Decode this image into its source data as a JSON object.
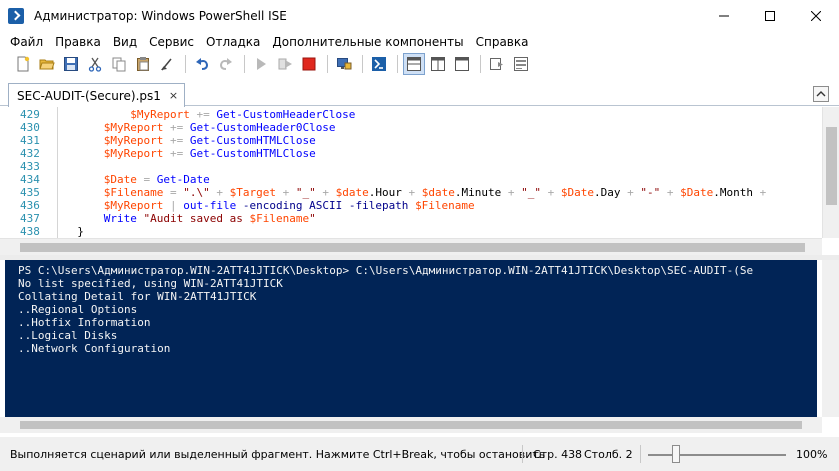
{
  "window": {
    "title": "Администратор: Windows PowerShell ISE",
    "controls": [
      "minimize-icon",
      "maximize-icon",
      "close-icon"
    ]
  },
  "menu": [
    "Файл",
    "Правка",
    "Вид",
    "Сервис",
    "Отладка",
    "Дополнительные компоненты",
    "Справка"
  ],
  "toolbar": {
    "buttons": [
      "new-icon",
      "open-icon",
      "save-icon",
      "cut-icon",
      "copy-icon",
      "paste-icon",
      "clear-icon",
      "undo-icon",
      "redo-icon",
      "run-icon",
      "run-selection-icon",
      "stop-icon",
      "remote-icon",
      "console-icon",
      "layout-top-icon",
      "layout-right-icon",
      "layout-max-icon",
      "snippets-icon",
      "commands-icon"
    ]
  },
  "tab": {
    "label": "SEC-AUDIT-(Secure).ps1",
    "close": "×"
  },
  "editor": {
    "lines": [
      {
        "num": "429",
        "code": [
          [
            "o",
            "          "
          ],
          [
            "v",
            "$MyReport"
          ],
          [
            "o",
            " += "
          ],
          [
            "c",
            "Get-CustomHeaderClose"
          ]
        ]
      },
      {
        "num": "430",
        "code": [
          [
            "o",
            "      "
          ],
          [
            "v",
            "$MyReport"
          ],
          [
            "o",
            " += "
          ],
          [
            "c",
            "Get-CustomHeader0Close"
          ]
        ]
      },
      {
        "num": "431",
        "code": [
          [
            "o",
            "      "
          ],
          [
            "v",
            "$MyReport"
          ],
          [
            "o",
            " += "
          ],
          [
            "c",
            "Get-CustomHTMLClose"
          ]
        ]
      },
      {
        "num": "432",
        "code": [
          [
            "o",
            "      "
          ],
          [
            "v",
            "$MyReport"
          ],
          [
            "o",
            " += "
          ],
          [
            "c",
            "Get-CustomHTMLClose"
          ]
        ]
      },
      {
        "num": "433",
        "code": []
      },
      {
        "num": "434",
        "code": [
          [
            "o",
            "      "
          ],
          [
            "v",
            "$Date"
          ],
          [
            "o",
            " = "
          ],
          [
            "c",
            "Get-Date"
          ]
        ]
      },
      {
        "num": "435",
        "code": [
          [
            "o",
            "      "
          ],
          [
            "v",
            "$Filename"
          ],
          [
            "o",
            " = "
          ],
          [
            "s",
            "\".\\\""
          ],
          [
            "o",
            " + "
          ],
          [
            "v",
            "$Target"
          ],
          [
            "o",
            " + "
          ],
          [
            "s",
            "\"_\""
          ],
          [
            "o",
            " + "
          ],
          [
            "v",
            "$date"
          ],
          [
            "t",
            "."
          ],
          [
            "t",
            "Hour"
          ],
          [
            "o",
            " + "
          ],
          [
            "v",
            "$date"
          ],
          [
            "t",
            ".Minute"
          ],
          [
            "o",
            " + "
          ],
          [
            "s",
            "\"_\""
          ],
          [
            "o",
            " + "
          ],
          [
            "v",
            "$Date"
          ],
          [
            "t",
            ".Day"
          ],
          [
            "o",
            " + "
          ],
          [
            "s",
            "\"-\""
          ],
          [
            "o",
            " + "
          ],
          [
            "v",
            "$Date"
          ],
          [
            "t",
            ".Month"
          ],
          [
            "o",
            " +"
          ]
        ]
      },
      {
        "num": "436",
        "code": [
          [
            "o",
            "      "
          ],
          [
            "v",
            "$MyReport"
          ],
          [
            "o",
            " | "
          ],
          [
            "c",
            "out-file"
          ],
          [
            "o",
            " "
          ],
          [
            "k",
            "-encoding"
          ],
          [
            "o",
            " "
          ],
          [
            "k",
            "ASCII"
          ],
          [
            "o",
            " "
          ],
          [
            "k",
            "-filepath"
          ],
          [
            "o",
            " "
          ],
          [
            "v",
            "$Filename"
          ]
        ]
      },
      {
        "num": "437",
        "code": [
          [
            "o",
            "      "
          ],
          [
            "c",
            "Write"
          ],
          [
            "o",
            " "
          ],
          [
            "s",
            "\"Audit saved as "
          ],
          [
            "v",
            "$Filename"
          ],
          [
            "s",
            "\""
          ]
        ]
      },
      {
        "num": "438",
        "code": [
          [
            "o",
            "  "
          ],
          [
            "t",
            "}"
          ]
        ]
      }
    ]
  },
  "console": {
    "lines": [
      "PS C:\\Users\\Администратор.WIN-2ATT41JTICK\\Desktop> C:\\Users\\Администратор.WIN-2ATT41JTICK\\Desktop\\SEC-AUDIT-(Se",
      "No list specified, using WIN-2ATT41JTICK",
      "Collating Detail for WIN-2ATT41JTICK",
      "..Regional Options",
      "..Hotfix Information",
      "..Logical Disks",
      "..Network Configuration"
    ]
  },
  "status": {
    "message": "Выполняется сценарий или выделенный фрагмент.  Нажмите Ctrl+Break, чтобы остановить",
    "line": "Стр. 438",
    "col": "Столб. 2",
    "zoom": "100%",
    "zoom_level": 0.2
  },
  "colors": {
    "console_bg": "#012456",
    "variable": "#ff4500",
    "command": "#0000ff",
    "string": "#8b0000",
    "line_number": "#2b91af"
  }
}
